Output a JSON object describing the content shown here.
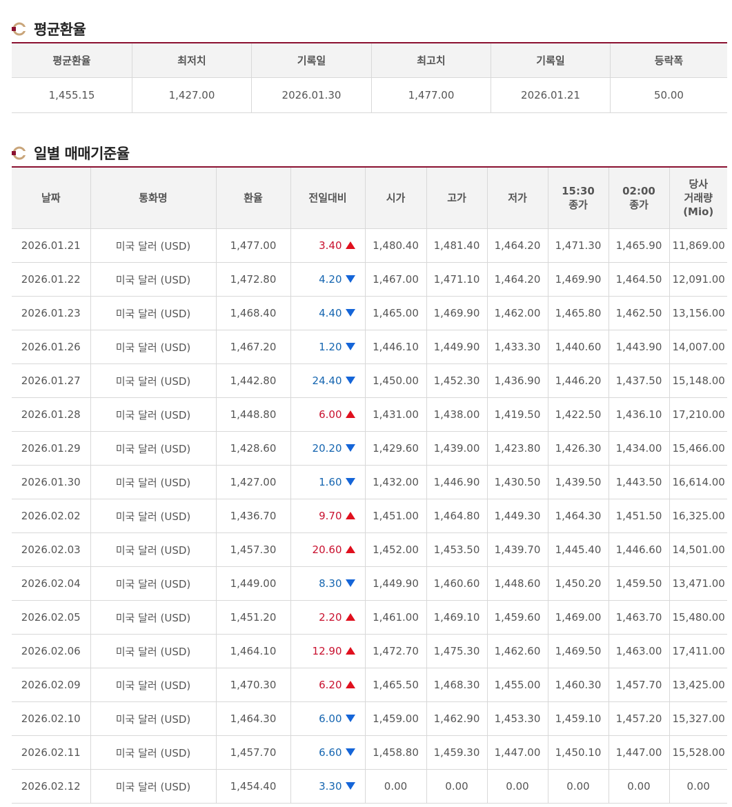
{
  "average_section": {
    "title": "평균환율",
    "headers": [
      "평균환율",
      "최저치",
      "기록일",
      "최고치",
      "기록일",
      "등락폭"
    ],
    "values": [
      "1,455.15",
      "1,427.00",
      "2026.01.30",
      "1,477.00",
      "2026.01.21",
      "50.00"
    ]
  },
  "daily_section": {
    "title": "일별 매매기준율",
    "headers": [
      "날짜",
      "통화명",
      "환율",
      "전일대비",
      "시가",
      "고가",
      "저가",
      "15:30\n종가",
      "02:00\n종가",
      "당사\n거래량\n(Mio)"
    ],
    "rows": [
      {
        "date": "2026.01.21",
        "currency": "미국 달러 (USD)",
        "rate": "1,477.00",
        "change": "3.40",
        "dir": "up",
        "open": "1,480.40",
        "high": "1,481.40",
        "low": "1,464.20",
        "close1530": "1,471.30",
        "close0200": "1,465.90",
        "volume": "11,869.00"
      },
      {
        "date": "2026.01.22",
        "currency": "미국 달러 (USD)",
        "rate": "1,472.80",
        "change": "4.20",
        "dir": "down",
        "open": "1,467.00",
        "high": "1,471.10",
        "low": "1,464.20",
        "close1530": "1,469.90",
        "close0200": "1,464.50",
        "volume": "12,091.00"
      },
      {
        "date": "2026.01.23",
        "currency": "미국 달러 (USD)",
        "rate": "1,468.40",
        "change": "4.40",
        "dir": "down",
        "open": "1,465.00",
        "high": "1,469.90",
        "low": "1,462.00",
        "close1530": "1,465.80",
        "close0200": "1,462.50",
        "volume": "13,156.00"
      },
      {
        "date": "2026.01.26",
        "currency": "미국 달러 (USD)",
        "rate": "1,467.20",
        "change": "1.20",
        "dir": "down",
        "open": "1,446.10",
        "high": "1,449.90",
        "low": "1,433.30",
        "close1530": "1,440.60",
        "close0200": "1,443.90",
        "volume": "14,007.00"
      },
      {
        "date": "2026.01.27",
        "currency": "미국 달러 (USD)",
        "rate": "1,442.80",
        "change": "24.40",
        "dir": "down",
        "open": "1,450.00",
        "high": "1,452.30",
        "low": "1,436.90",
        "close1530": "1,446.20",
        "close0200": "1,437.50",
        "volume": "15,148.00"
      },
      {
        "date": "2026.01.28",
        "currency": "미국 달러 (USD)",
        "rate": "1,448.80",
        "change": "6.00",
        "dir": "up",
        "open": "1,431.00",
        "high": "1,438.00",
        "low": "1,419.50",
        "close1530": "1,422.50",
        "close0200": "1,436.10",
        "volume": "17,210.00"
      },
      {
        "date": "2026.01.29",
        "currency": "미국 달러 (USD)",
        "rate": "1,428.60",
        "change": "20.20",
        "dir": "down",
        "open": "1,429.60",
        "high": "1,439.00",
        "low": "1,423.80",
        "close1530": "1,426.30",
        "close0200": "1,434.00",
        "volume": "15,466.00"
      },
      {
        "date": "2026.01.30",
        "currency": "미국 달러 (USD)",
        "rate": "1,427.00",
        "change": "1.60",
        "dir": "down",
        "open": "1,432.00",
        "high": "1,446.90",
        "low": "1,430.50",
        "close1530": "1,439.50",
        "close0200": "1,443.50",
        "volume": "16,614.00"
      },
      {
        "date": "2026.02.02",
        "currency": "미국 달러 (USD)",
        "rate": "1,436.70",
        "change": "9.70",
        "dir": "up",
        "open": "1,451.00",
        "high": "1,464.80",
        "low": "1,449.30",
        "close1530": "1,464.30",
        "close0200": "1,451.50",
        "volume": "16,325.00"
      },
      {
        "date": "2026.02.03",
        "currency": "미국 달러 (USD)",
        "rate": "1,457.30",
        "change": "20.60",
        "dir": "up",
        "open": "1,452.00",
        "high": "1,453.50",
        "low": "1,439.70",
        "close1530": "1,445.40",
        "close0200": "1,446.60",
        "volume": "14,501.00"
      },
      {
        "date": "2026.02.04",
        "currency": "미국 달러 (USD)",
        "rate": "1,449.00",
        "change": "8.30",
        "dir": "down",
        "open": "1,449.90",
        "high": "1,460.60",
        "low": "1,448.60",
        "close1530": "1,450.20",
        "close0200": "1,459.50",
        "volume": "13,471.00"
      },
      {
        "date": "2026.02.05",
        "currency": "미국 달러 (USD)",
        "rate": "1,451.20",
        "change": "2.20",
        "dir": "up",
        "open": "1,461.00",
        "high": "1,469.10",
        "low": "1,459.60",
        "close1530": "1,469.00",
        "close0200": "1,463.70",
        "volume": "15,480.00"
      },
      {
        "date": "2026.02.06",
        "currency": "미국 달러 (USD)",
        "rate": "1,464.10",
        "change": "12.90",
        "dir": "up",
        "open": "1,472.70",
        "high": "1,475.30",
        "low": "1,462.60",
        "close1530": "1,469.50",
        "close0200": "1,463.00",
        "volume": "17,411.00"
      },
      {
        "date": "2026.02.09",
        "currency": "미국 달러 (USD)",
        "rate": "1,470.30",
        "change": "6.20",
        "dir": "up",
        "open": "1,465.50",
        "high": "1,468.30",
        "low": "1,455.00",
        "close1530": "1,460.30",
        "close0200": "1,457.70",
        "volume": "13,425.00"
      },
      {
        "date": "2026.02.10",
        "currency": "미국 달러 (USD)",
        "rate": "1,464.30",
        "change": "6.00",
        "dir": "down",
        "open": "1,459.00",
        "high": "1,462.90",
        "low": "1,453.30",
        "close1530": "1,459.10",
        "close0200": "1,457.20",
        "volume": "15,327.00"
      },
      {
        "date": "2026.02.11",
        "currency": "미국 달러 (USD)",
        "rate": "1,457.70",
        "change": "6.60",
        "dir": "down",
        "open": "1,458.80",
        "high": "1,459.30",
        "low": "1,447.00",
        "close1530": "1,450.10",
        "close0200": "1,447.00",
        "volume": "15,528.00"
      },
      {
        "date": "2026.02.12",
        "currency": "미국 달러 (USD)",
        "rate": "1,454.40",
        "change": "3.30",
        "dir": "down",
        "open": "0.00",
        "high": "0.00",
        "low": "0.00",
        "close1530": "0.00",
        "close0200": "0.00",
        "volume": "0.00"
      }
    ]
  },
  "colors": {
    "accent": "#8a1030",
    "up": "#c8102e",
    "down": "#1565b0",
    "header_bg": "#f3f3f3"
  },
  "icons": {
    "section": "ring-bullet-icon"
  }
}
